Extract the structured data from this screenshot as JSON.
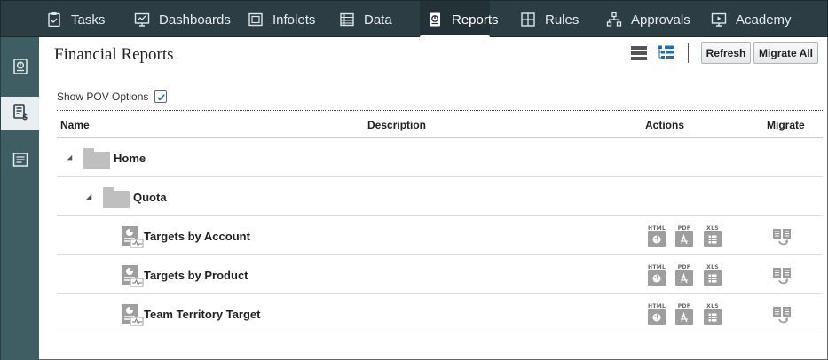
{
  "nav": {
    "items": [
      {
        "label": "Tasks",
        "icon": "clipboard-check-icon"
      },
      {
        "label": "Dashboards",
        "icon": "monitor-chart-icon"
      },
      {
        "label": "Infolets",
        "icon": "infolet-icon"
      },
      {
        "label": "Data",
        "icon": "data-grid-icon"
      },
      {
        "label": "Reports",
        "icon": "report-icon",
        "active": true
      },
      {
        "label": "Rules",
        "icon": "rules-icon"
      },
      {
        "label": "Approvals",
        "icon": "approvals-hierarchy-icon"
      },
      {
        "label": "Academy",
        "icon": "academy-play-icon"
      }
    ]
  },
  "rail": {
    "items": [
      {
        "name": "reports-rail-icon"
      },
      {
        "name": "financial-reports-rail-icon",
        "active": true
      },
      {
        "name": "documents-rail-icon"
      }
    ]
  },
  "page": {
    "title": "Financial Reports",
    "refresh_label": "Refresh",
    "migrate_all_label": "Migrate All",
    "pov_label": "Show POV Options",
    "pov_checked": true
  },
  "table": {
    "columns": {
      "name": "Name",
      "description": "Description",
      "actions": "Actions",
      "migrate": "Migrate"
    },
    "rows": [
      {
        "label": "Home",
        "type": "folder",
        "level": 0
      },
      {
        "label": "Quota",
        "type": "folder",
        "level": 1
      },
      {
        "label": "Targets by Account",
        "type": "report",
        "level": 2
      },
      {
        "label": "Targets by Product",
        "type": "report",
        "level": 2
      },
      {
        "label": "Team Territory Target",
        "type": "report",
        "level": 2
      }
    ],
    "action_tags": {
      "html": "HTML",
      "pdf": "PDF",
      "xls": "XLS"
    }
  },
  "colors": {
    "nav_bg": "#2c3e43",
    "rail_bg": "#3e5e63",
    "accent": "#1a6fb5",
    "icon_gray": "#9e9e9e"
  }
}
